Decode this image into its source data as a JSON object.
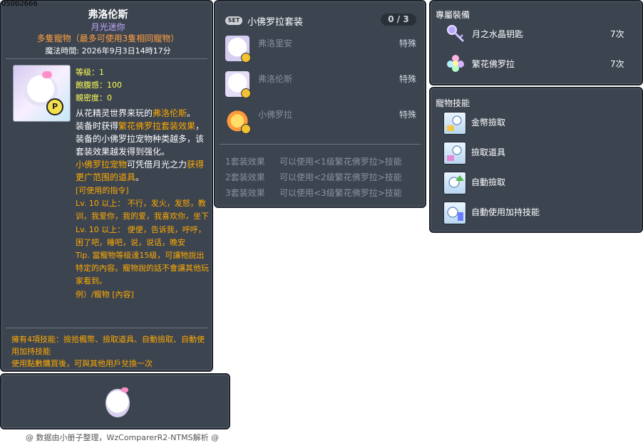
{
  "item_id": "05002666",
  "main": {
    "title": "弗洛伦斯",
    "subtitle": "月光迷你",
    "multi": "多隻寵物（最多可使用3隻相同寵物）",
    "expire": "魔法時間: 2026年9月3日14時17分",
    "stats": {
      "level": "等级：1",
      "fullness": "飽腹感：100",
      "closeness": "親密度：0"
    },
    "desc": {
      "p1": "从花精灵世界来玩的",
      "p1_hl": "弗洛伦斯",
      "p1_end": "。",
      "p2": "装备时获得",
      "p2_hl": "繁花佛罗拉套装效果",
      "p2_end": "，装备的小佛罗拉宠物种类越多，该套装效果越发得到强化。",
      "p3_hl": "小佛罗拉宠物",
      "p3": "可凭借月光之力",
      "p3_hl2": "获得更广范围的道具",
      "p3_end": "。"
    },
    "commands": {
      "header": "[可使用的指令]",
      "lv1": "Lv. 10 以上： 不行，发火，发怒，教训，我爱你，我的爱，我喜欢你，坐下",
      "lv2": "Lv. 10 以上： 便便，告诉我，呼呼，困了吧，睡吧，说，说话，晚安",
      "tip": "Tip. 當寵物等级達15级，可讓牠說出特定的內容。寵物說的話不會讓其他玩家看到。",
      "example": "例）/寵物 [內容]"
    },
    "skills_line": "擁有4項技能：撿拾楓幣、撿取道具、自動撿取、自動使用加持技能",
    "trade_line": "使用點數購買後，可與其他用戶兌換一次"
  },
  "footer": "@ 数据由小册子整理，WzComparerR2-NTMS解析 @",
  "set": {
    "badge": "SET",
    "title": "小佛罗拉套装",
    "count": "0 / 3",
    "items": [
      {
        "name": "弗洛里安",
        "type": "特殊"
      },
      {
        "name": "弗洛伦斯",
        "type": "特殊"
      },
      {
        "name": "小佛罗拉",
        "type": "特殊"
      }
    ],
    "effects": [
      {
        "label": "1套装效果",
        "text": "可以使用<1级繁花佛罗拉>技能"
      },
      {
        "label": "2套装效果",
        "text": "可以使用<2级繁花佛罗拉>技能"
      },
      {
        "label": "3套装效果",
        "text": "可以使用<3级繁花佛罗拉>技能"
      }
    ]
  },
  "equip": {
    "title": "專屬裝備",
    "items": [
      {
        "name": "月之水晶钥匙",
        "count": "7次",
        "icon": "key-icon"
      },
      {
        "name": "繁花佛罗拉",
        "count": "7次",
        "icon": "flower-icon"
      }
    ]
  },
  "pet_skills": {
    "title": "寵物技能",
    "items": [
      {
        "name": "金幣撿取"
      },
      {
        "name": "撿取道具"
      },
      {
        "name": "自動撿取"
      },
      {
        "name": "自動使用加持技能"
      }
    ]
  }
}
